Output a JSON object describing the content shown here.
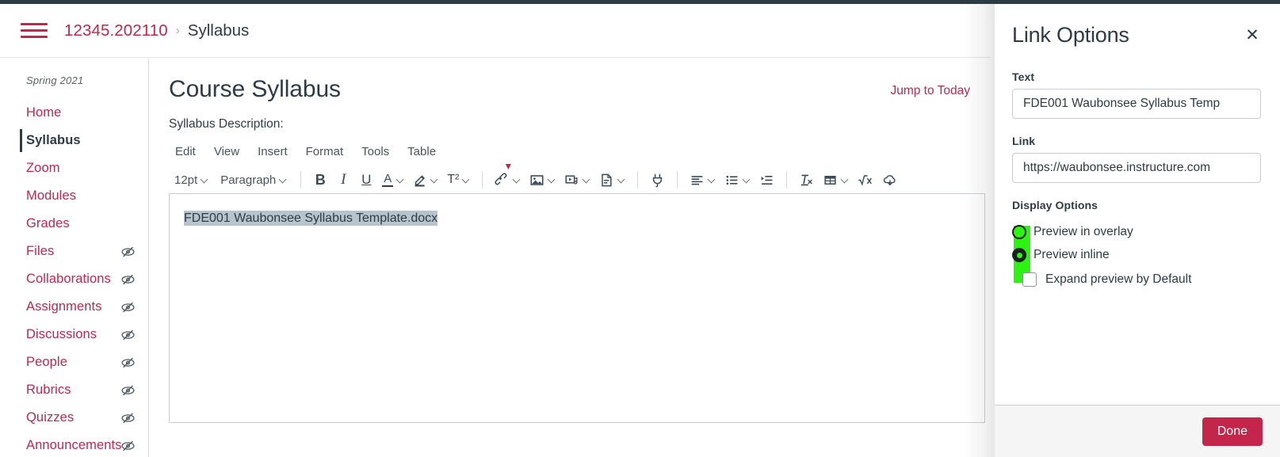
{
  "breadcrumb": {
    "menu_icon": "hamburger-icon",
    "course_code": "12345.202110",
    "separator": "›",
    "current": "Syllabus"
  },
  "course_nav": {
    "term": "Spring 2021",
    "hidden_icon": "eye-slash-icon",
    "items": [
      {
        "label": "Home",
        "active": false,
        "hidden": false
      },
      {
        "label": "Syllabus",
        "active": true,
        "hidden": false
      },
      {
        "label": "Zoom",
        "active": false,
        "hidden": false
      },
      {
        "label": "Modules",
        "active": false,
        "hidden": false
      },
      {
        "label": "Grades",
        "active": false,
        "hidden": false
      },
      {
        "label": "Files",
        "active": false,
        "hidden": true
      },
      {
        "label": "Collaborations",
        "active": false,
        "hidden": true
      },
      {
        "label": "Assignments",
        "active": false,
        "hidden": true
      },
      {
        "label": "Discussions",
        "active": false,
        "hidden": true
      },
      {
        "label": "People",
        "active": false,
        "hidden": true
      },
      {
        "label": "Rubrics",
        "active": false,
        "hidden": true
      },
      {
        "label": "Quizzes",
        "active": false,
        "hidden": true
      },
      {
        "label": "Announcements",
        "active": false,
        "hidden": true
      }
    ]
  },
  "main": {
    "page_title": "Course Syllabus",
    "jump_to_today": "Jump to Today",
    "description_label": "Syllabus Description:"
  },
  "editor": {
    "menubar": [
      "Edit",
      "View",
      "Insert",
      "Format",
      "Tools",
      "Table"
    ],
    "font_size": "12pt",
    "block_format": "Paragraph",
    "buttons": {
      "bold": "B",
      "italic": "I",
      "underline": "U",
      "text_color": "A",
      "highlight": "highlighter-icon",
      "superscript": "T²",
      "link": "link-icon",
      "image": "image-icon",
      "media": "media-icon",
      "document": "document-icon",
      "apps": "plug-icon",
      "align": "align-left-icon",
      "list": "bullet-list-icon",
      "indent": "indent-icon",
      "clear_format": "clear-formatting-icon",
      "table": "table-icon",
      "equation": "equation-icon",
      "cloud": "cloud-icon"
    },
    "content_text": "FDE001 Waubonsee Syllabus Template.docx"
  },
  "tray": {
    "title": "Link Options",
    "close_icon": "close-icon",
    "text_field": {
      "label": "Text",
      "value": "FDE001 Waubonsee Syllabus Temp"
    },
    "link_field": {
      "label": "Link",
      "value": "https://waubonsee.instructure.com"
    },
    "display_options": {
      "label": "Display Options",
      "radios": [
        {
          "label": "Preview in overlay",
          "checked": false
        },
        {
          "label": "Preview inline",
          "checked": true
        }
      ],
      "checkbox": {
        "label": "Expand preview by Default",
        "checked": false
      }
    },
    "done_label": "Done",
    "highlight_color": "#2cf312"
  },
  "theme": {
    "brand": "#c3264a",
    "text": "#2d3b45",
    "border": "#c7cdd1"
  }
}
